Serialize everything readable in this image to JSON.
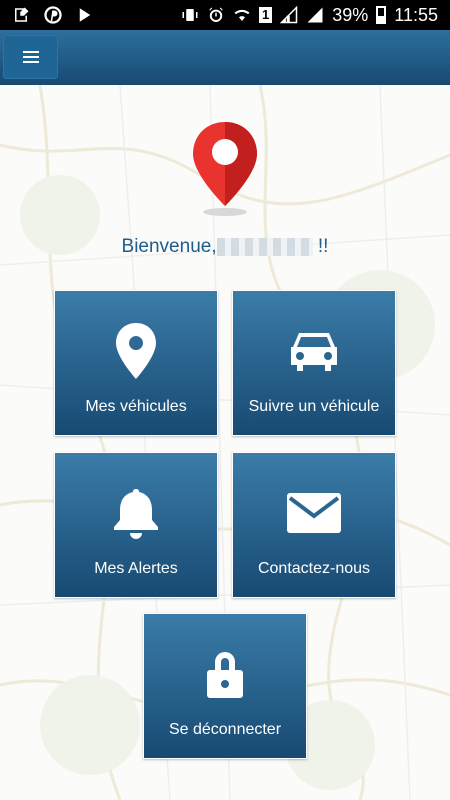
{
  "status_bar": {
    "battery": "39%",
    "time": "11:55",
    "sim_slot": "1",
    "icons": [
      "notification-icon",
      "pinterest-icon",
      "play-store-icon",
      "vibrate-icon",
      "alarm-icon",
      "wifi-icon",
      "sim-signal-icon",
      "signal-icon",
      "battery-icon"
    ]
  },
  "app_bar": {
    "menu_icon": "hamburger-menu-icon"
  },
  "main": {
    "greeting_prefix": "Bienvenue,",
    "greeting_suffix": "!!"
  },
  "tiles": {
    "vehicles": {
      "label": "Mes véhicules",
      "icon": "location-pin-icon"
    },
    "track": {
      "label": "Suivre un véhicule",
      "icon": "car-icon"
    },
    "alerts": {
      "label": "Mes Alertes",
      "icon": "bell-icon"
    },
    "contact": {
      "label": "Contactez-nous",
      "icon": "envelope-icon"
    },
    "logout": {
      "label": "Se déconnecter",
      "icon": "lock-icon"
    }
  },
  "colors": {
    "accent": "#1f5d8a",
    "tile_top": "#3b7ca8",
    "tile_bottom": "#174a73",
    "pin_red": "#e8332f"
  }
}
